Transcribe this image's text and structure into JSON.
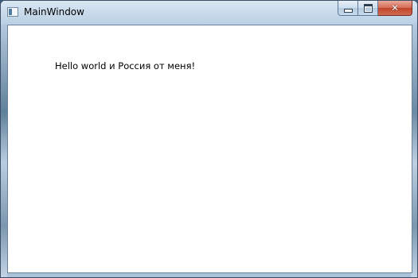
{
  "window": {
    "title": "MainWindow",
    "caption_buttons": {
      "minimize": "minimize",
      "maximize": "maximize",
      "close": "close"
    }
  },
  "content": {
    "label_text": "Hello world и Россия от меня!"
  },
  "colors": {
    "client_background": "#ffffff",
    "close_button": "#c0432a"
  }
}
